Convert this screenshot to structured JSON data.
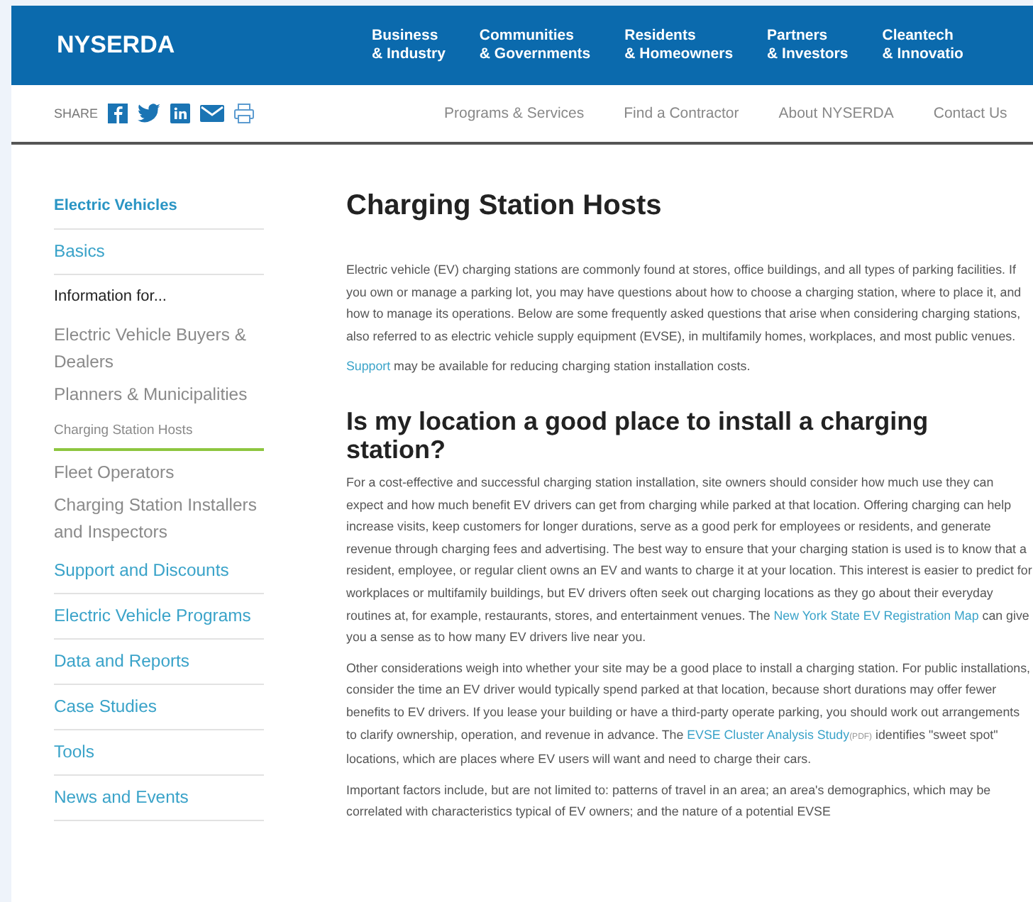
{
  "header": {
    "logo": "NYSERDA",
    "nav": [
      {
        "line1": "Business",
        "line2": "& Industry"
      },
      {
        "line1": "Communities",
        "line2": "& Governments"
      },
      {
        "line1": "Residents",
        "line2": "& Homeowners"
      },
      {
        "line1": "Partners",
        "line2": "& Investors"
      },
      {
        "line1": "Cleantech",
        "line2": "& Innovatio"
      }
    ]
  },
  "subnav": {
    "share_label": "SHARE",
    "share_icons": [
      {
        "kind": "facebook"
      },
      {
        "kind": "twitter"
      },
      {
        "kind": "linkedin"
      },
      {
        "kind": "email"
      },
      {
        "kind": "print"
      }
    ],
    "links": [
      "Programs & Services",
      "Find a Contractor",
      "About NYSERDA",
      "Contact Us"
    ]
  },
  "sidebar": {
    "items": [
      {
        "label": "Electric Vehicles",
        "kind": "title",
        "selected": false
      },
      {
        "label": "Basics",
        "kind": "link",
        "selected": false
      },
      {
        "label": "Information for...",
        "kind": "heading",
        "selected": false
      },
      {
        "label": "Electric Vehicle Buyers & Dealers",
        "kind": "sub",
        "selected": false
      },
      {
        "label": "Planners & Municipalities",
        "kind": "sub",
        "selected": false
      },
      {
        "label": "Charging Station Hosts",
        "kind": "sub",
        "selected": true
      },
      {
        "label": "Fleet Operators",
        "kind": "sub",
        "selected": false
      },
      {
        "label": "Charging Station Installers and Inspectors",
        "kind": "sub",
        "selected": false
      },
      {
        "label": "Support and Discounts",
        "kind": "link",
        "selected": false
      },
      {
        "label": "Electric Vehicle Programs",
        "kind": "link",
        "selected": false
      },
      {
        "label": "Data and Reports",
        "kind": "link",
        "selected": false
      },
      {
        "label": "Case Studies",
        "kind": "link",
        "selected": false
      },
      {
        "label": "Tools",
        "kind": "link",
        "selected": false
      },
      {
        "label": "News and Events",
        "kind": "link",
        "selected": false
      }
    ]
  },
  "article": {
    "title": "Charging Station Hosts",
    "blocks": [
      {
        "kind": "paragraph",
        "parts": [
          {
            "text": "Electric vehicle (EV) charging stations are commonly found at stores, office buildings, and all types of parking facilities. If you own or manage a parking lot, you may have questions about how to choose a charging station, where to place it, and how to manage its operations.  Below are some frequently asked questions that arise when considering charging stations, also referred to as electric vehicle supply equipment (EVSE), in multifamily homes, workplaces, and most public venues."
          }
        ]
      },
      {
        "kind": "paragraph",
        "parts": [
          {
            "text": "Support",
            "kind": "link"
          },
          {
            "text": " may be available for reducing charging station installation costs."
          }
        ]
      },
      {
        "kind": "heading",
        "parts": [
          {
            "text": "Is my location a good place to install a charging station?"
          }
        ]
      },
      {
        "kind": "paragraph",
        "parts": [
          {
            "text": "For a cost-effective and successful charging station installation, site owners should consider how much use they can expect and how much benefit EV drivers can get from charging while parked at that location. Offering charging can help increase visits, keep customers for longer durations, serve as a good perk for employees or residents, and generate revenue through charging fees and advertising. The best way to ensure that your charging station is used is to know that a resident, employee, or regular client owns an EV and wants to charge it at your location. This interest is easier to predict for workplaces or multifamily buildings, but EV drivers often seek out charging locations as they go about their everyday routines at, for example, restaurants, stores, and entertainment venues. The "
          },
          {
            "text": "New York State EV Registration Map",
            "kind": "link"
          },
          {
            "text": " can give you a sense as to how many EV drivers live near you."
          }
        ]
      },
      {
        "kind": "paragraph",
        "parts": [
          {
            "text": "Other considerations weigh into whether your site may be a good place to install a charging station. For public installations, consider the time an EV driver would typically spend parked at that location, because short durations may offer fewer benefits to EV drivers. If you lease your building or have a third-party operate parking, you should work out arrangements to clarify ownership, operation, and revenue in advance. The "
          },
          {
            "text": "EVSE Cluster Analysis Study",
            "kind": "link"
          },
          {
            "text": "(PDF)",
            "kind": "tag"
          },
          {
            "text": " identifies \"sweet spot\" locations, which are places where EV users will want and need to charge their cars."
          }
        ]
      },
      {
        "kind": "paragraph",
        "parts": [
          {
            "text": "Important factors include, but are not limited to: patterns of travel in an area; an area's demographics, which may be correlated with characteristics typical of EV owners; and the nature of a potential EVSE"
          }
        ]
      }
    ]
  }
}
